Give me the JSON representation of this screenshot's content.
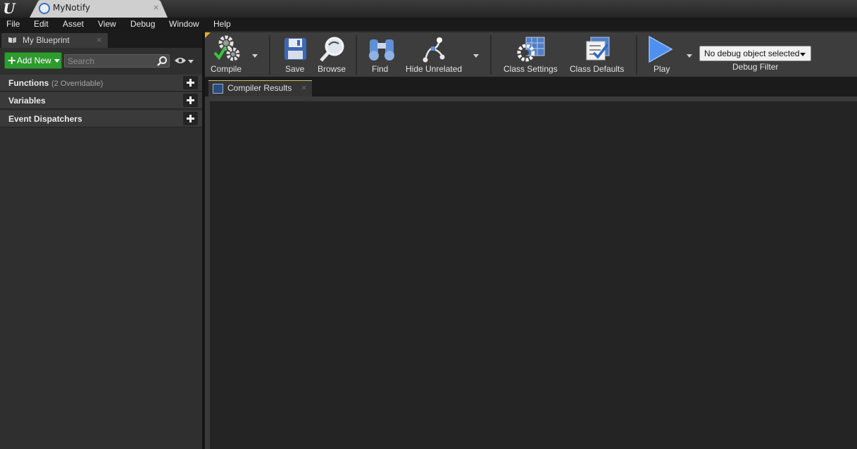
{
  "window": {
    "tab_title": "MyNotify",
    "close_glyph": "×"
  },
  "menu": [
    "File",
    "Edit",
    "Asset",
    "View",
    "Debug",
    "Window",
    "Help"
  ],
  "my_blueprint": {
    "tab_label": "My Blueprint",
    "close_glyph": "×",
    "add_new_label": "Add New",
    "search_placeholder": "Search",
    "sections": [
      {
        "title": "Functions",
        "sub": "(2 Overridable)"
      },
      {
        "title": "Variables",
        "sub": ""
      },
      {
        "title": "Event Dispatchers",
        "sub": ""
      }
    ]
  },
  "toolbar": {
    "compile": "Compile",
    "save": "Save",
    "browse": "Browse",
    "find": "Find",
    "hide_unrelated": "Hide Unrelated",
    "class_settings": "Class Settings",
    "class_defaults": "Class Defaults",
    "play": "Play",
    "debug_object": "No debug object selected",
    "debug_filter": "Debug Filter"
  },
  "compiler_results": {
    "tab_label": "Compiler Results",
    "close_glyph": "×"
  },
  "icons": {
    "app": "unreal-engine-logo-icon",
    "compile": "gears-checkmark-icon",
    "save": "floppy-disk-icon",
    "browse": "magnifier-icon",
    "find": "binoculars-icon",
    "hide_unrelated": "node-graph-icon",
    "class_settings": "gear-grid-icon",
    "class_defaults": "checklist-icon",
    "play": "play-triangle-icon"
  },
  "colors": {
    "add_new_green": "#2f9a2f",
    "compile_check": "#3cc43c",
    "play_blue": "#4f8ff0",
    "tab_accent": "#e2b11f"
  }
}
